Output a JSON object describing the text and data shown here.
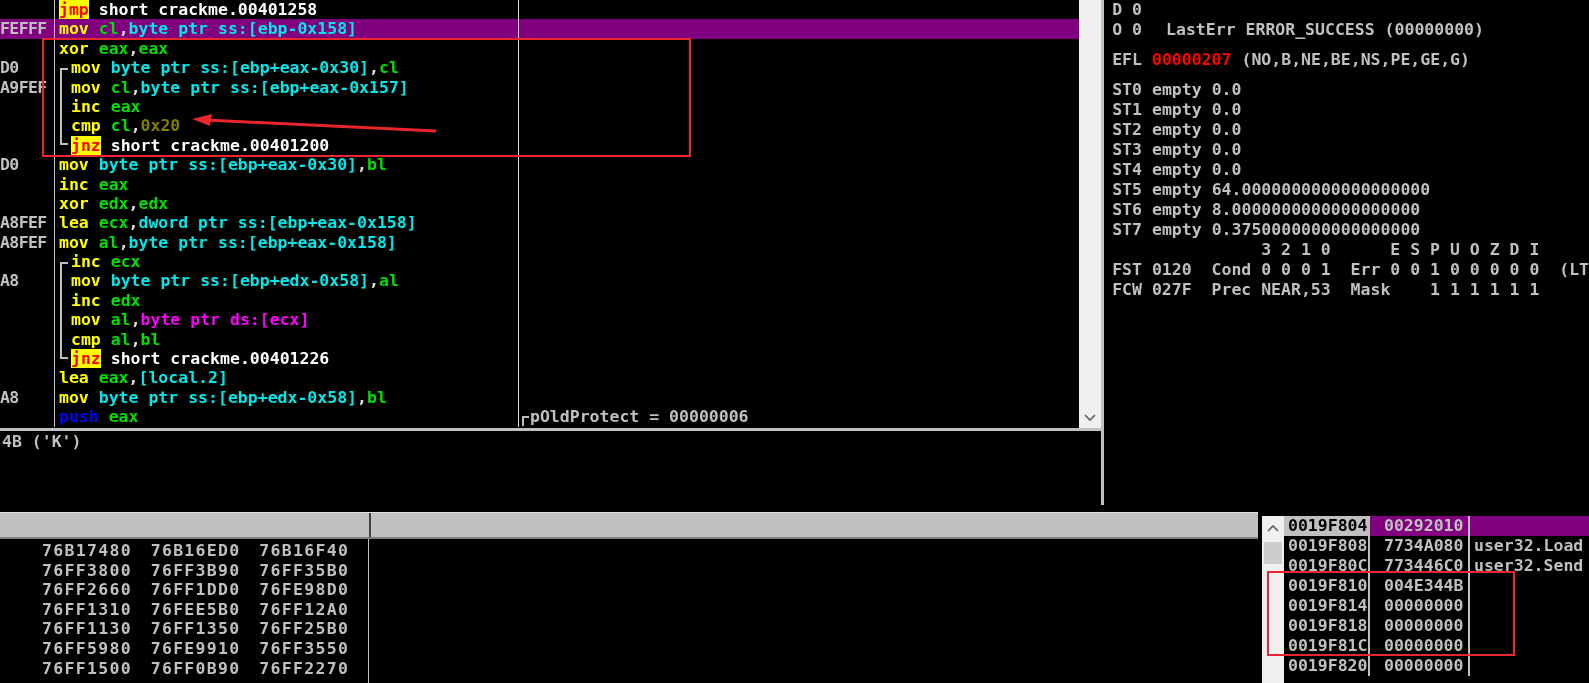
{
  "disassembly": {
    "rows": [
      {
        "bytes": "",
        "kind": "plain",
        "selected": false,
        "mnemonic": {
          "text": "jmp",
          "kind": "jump"
        },
        "operands": [
          {
            "text": "short crackme.00401258",
            "kind": "label"
          }
        ]
      },
      {
        "bytes": "FEFFF",
        "kind": "plain",
        "selected": true,
        "mnemonic": {
          "text": "mov",
          "kind": "op"
        },
        "operands": [
          {
            "text": "cl",
            "kind": "reg"
          },
          {
            "text": ",",
            "kind": "punct"
          },
          {
            "text": "byte ptr ss:[ebp-0x158]",
            "kind": "mem"
          }
        ]
      },
      {
        "bytes": "",
        "kind": "plain",
        "selected": false,
        "mnemonic": {
          "text": "xor",
          "kind": "op"
        },
        "operands": [
          {
            "text": "eax",
            "kind": "reg"
          },
          {
            "text": ",",
            "kind": "punct"
          },
          {
            "text": "eax",
            "kind": "reg"
          }
        ]
      },
      {
        "bytes": "D0",
        "kind": "loop_start",
        "selected": false,
        "mnemonic": {
          "text": "mov",
          "kind": "op"
        },
        "operands": [
          {
            "text": "byte ptr ss:[ebp+eax-0x30]",
            "kind": "mem"
          },
          {
            "text": ",",
            "kind": "punct"
          },
          {
            "text": "cl",
            "kind": "reg"
          }
        ]
      },
      {
        "bytes": "A9FEF",
        "kind": "loop_mid",
        "selected": false,
        "mnemonic": {
          "text": "mov",
          "kind": "op"
        },
        "operands": [
          {
            "text": "cl",
            "kind": "reg"
          },
          {
            "text": ",",
            "kind": "punct"
          },
          {
            "text": "byte ptr ss:[ebp+eax-0x157]",
            "kind": "mem"
          }
        ]
      },
      {
        "bytes": "",
        "kind": "loop_mid",
        "selected": false,
        "mnemonic": {
          "text": "inc",
          "kind": "op"
        },
        "operands": [
          {
            "text": "eax",
            "kind": "reg"
          }
        ]
      },
      {
        "bytes": "",
        "kind": "loop_mid",
        "selected": false,
        "mnemonic": {
          "text": "cmp",
          "kind": "op"
        },
        "operands": [
          {
            "text": "cl",
            "kind": "reg"
          },
          {
            "text": ",",
            "kind": "punct"
          },
          {
            "text": "0x20",
            "kind": "imm"
          }
        ]
      },
      {
        "bytes": "",
        "kind": "loop_end",
        "selected": false,
        "mnemonic": {
          "text": "jnz",
          "kind": "jump"
        },
        "operands": [
          {
            "text": "short crackme.00401200",
            "kind": "label"
          }
        ]
      },
      {
        "bytes": "D0",
        "kind": "plain",
        "selected": false,
        "mnemonic": {
          "text": "mov",
          "kind": "op"
        },
        "operands": [
          {
            "text": "byte ptr ss:[ebp+eax-0x30]",
            "kind": "mem"
          },
          {
            "text": ",",
            "kind": "punct"
          },
          {
            "text": "bl",
            "kind": "reg"
          }
        ]
      },
      {
        "bytes": "",
        "kind": "plain",
        "selected": false,
        "mnemonic": {
          "text": "inc",
          "kind": "op"
        },
        "operands": [
          {
            "text": "eax",
            "kind": "reg"
          }
        ]
      },
      {
        "bytes": "",
        "kind": "plain",
        "selected": false,
        "mnemonic": {
          "text": "xor",
          "kind": "op"
        },
        "operands": [
          {
            "text": "edx",
            "kind": "reg"
          },
          {
            "text": ",",
            "kind": "punct"
          },
          {
            "text": "edx",
            "kind": "reg"
          }
        ]
      },
      {
        "bytes": "A8FEF",
        "kind": "plain",
        "selected": false,
        "mnemonic": {
          "text": "lea",
          "kind": "op"
        },
        "operands": [
          {
            "text": "ecx",
            "kind": "reg"
          },
          {
            "text": ",",
            "kind": "punct"
          },
          {
            "text": "dword ptr ss:[ebp+eax-0x158]",
            "kind": "mem"
          }
        ]
      },
      {
        "bytes": "A8FEF",
        "kind": "plain",
        "selected": false,
        "mnemonic": {
          "text": "mov",
          "kind": "op"
        },
        "operands": [
          {
            "text": "al",
            "kind": "reg"
          },
          {
            "text": ",",
            "kind": "punct"
          },
          {
            "text": "byte ptr ss:[ebp+eax-0x158]",
            "kind": "mem"
          }
        ]
      },
      {
        "bytes": "",
        "kind": "loop_start",
        "selected": false,
        "mnemonic": {
          "text": "inc",
          "kind": "op"
        },
        "operands": [
          {
            "text": "ecx",
            "kind": "reg"
          }
        ]
      },
      {
        "bytes": "A8",
        "kind": "loop_mid",
        "selected": false,
        "mnemonic": {
          "text": "mov",
          "kind": "op"
        },
        "operands": [
          {
            "text": "byte ptr ss:[ebp+edx-0x58]",
            "kind": "mem"
          },
          {
            "text": ",",
            "kind": "punct"
          },
          {
            "text": "al",
            "kind": "reg"
          }
        ]
      },
      {
        "bytes": "",
        "kind": "loop_mid",
        "selected": false,
        "mnemonic": {
          "text": "inc",
          "kind": "op"
        },
        "operands": [
          {
            "text": "edx",
            "kind": "reg"
          }
        ]
      },
      {
        "bytes": "",
        "kind": "loop_mid",
        "selected": false,
        "mnemonic": {
          "text": "mov",
          "kind": "op"
        },
        "operands": [
          {
            "text": "al",
            "kind": "reg"
          },
          {
            "text": ",",
            "kind": "punct"
          },
          {
            "text": "byte ptr ds:[ecx]",
            "kind": "memds"
          }
        ]
      },
      {
        "bytes": "",
        "kind": "loop_mid",
        "selected": false,
        "mnemonic": {
          "text": "cmp",
          "kind": "op"
        },
        "operands": [
          {
            "text": "al",
            "kind": "reg"
          },
          {
            "text": ",",
            "kind": "punct"
          },
          {
            "text": "bl",
            "kind": "reg"
          }
        ]
      },
      {
        "bytes": "",
        "kind": "loop_end",
        "selected": false,
        "mnemonic": {
          "text": "jnz",
          "kind": "jump"
        },
        "operands": [
          {
            "text": "short crackme.00401226",
            "kind": "label"
          }
        ]
      },
      {
        "bytes": "",
        "kind": "plain",
        "selected": false,
        "mnemonic": {
          "text": "lea",
          "kind": "op"
        },
        "operands": [
          {
            "text": "eax",
            "kind": "reg"
          },
          {
            "text": ",",
            "kind": "punct"
          },
          {
            "text": "[local.2]",
            "kind": "mem"
          }
        ]
      },
      {
        "bytes": "A8",
        "kind": "plain",
        "selected": false,
        "mnemonic": {
          "text": "mov",
          "kind": "op"
        },
        "operands": [
          {
            "text": "byte ptr ss:[ebp+edx-0x58]",
            "kind": "mem"
          },
          {
            "text": ",",
            "kind": "punct"
          },
          {
            "text": "bl",
            "kind": "reg"
          }
        ]
      },
      {
        "bytes": "",
        "kind": "plain",
        "selected": false,
        "mnemonic": {
          "text": "push",
          "kind": "stack"
        },
        "operands": [
          {
            "text": "eax",
            "kind": "reg"
          }
        ],
        "comment": "pOldProtect = 00000006"
      }
    ]
  },
  "info": {
    "text": "4B ('K')"
  },
  "registers": {
    "groups": [
      [
        {
          "kind": "flag",
          "name": "D",
          "value": "0"
        },
        {
          "kind": "flag",
          "name": "O",
          "value": "0",
          "note": "LastErr ERROR_SUCCESS (00000000)"
        }
      ],
      [
        {
          "kind": "efl",
          "name": "EFL",
          "value": "00000207",
          "changed": true,
          "note": "(NO,B,NE,BE,NS,PE,GE,G)"
        }
      ],
      [
        {
          "kind": "fpu",
          "name": "ST0",
          "tag": "empty",
          "value": "0.0"
        },
        {
          "kind": "fpu",
          "name": "ST1",
          "tag": "empty",
          "value": "0.0"
        },
        {
          "kind": "fpu",
          "name": "ST2",
          "tag": "empty",
          "value": "0.0"
        },
        {
          "kind": "fpu",
          "name": "ST3",
          "tag": "empty",
          "value": "0.0"
        },
        {
          "kind": "fpu",
          "name": "ST4",
          "tag": "empty",
          "value": "0.0"
        },
        {
          "kind": "fpu",
          "name": "ST5",
          "tag": "empty",
          "value": "64.0000000000000000000"
        },
        {
          "kind": "fpu",
          "name": "ST6",
          "tag": "empty",
          "value": "8.0000000000000000000"
        },
        {
          "kind": "fpu",
          "name": "ST7",
          "tag": "empty",
          "value": "0.3750000000000000000"
        },
        {
          "kind": "bits",
          "text": "3 2 1 0      E S P U O Z D I"
        },
        {
          "kind": "text",
          "text": "FST 0120  Cond 0 0 0 1  Err 0 0 1 0 0 0 0 0  (LT"
        },
        {
          "kind": "text",
          "text": "FCW 027F  Prec NEAR,53  Mask    1 1 1 1 1 1"
        }
      ]
    ]
  },
  "dump": {
    "rows": [
      [
        "76B17480",
        "76B16ED0",
        "76B16F40"
      ],
      [
        "76FF3800",
        "76FF3B90",
        "76FF35B0"
      ],
      [
        "76FF2660",
        "76FF1DD0",
        "76FE98D0"
      ],
      [
        "76FF1310",
        "76FEE5B0",
        "76FF12A0"
      ],
      [
        "76FF1130",
        "76FF1350",
        "76FF25B0"
      ],
      [
        "76FF5980",
        "76FE9910",
        "76FF3550"
      ],
      [
        "76FF1500",
        "76FF0B90",
        "76FF2270"
      ]
    ]
  },
  "stack": {
    "rows": [
      {
        "address": "0019F804",
        "value": "00292010",
        "selected": true
      },
      {
        "address": "0019F808",
        "value": "7734A080",
        "comment": "user32.Load",
        "selected": false
      },
      {
        "address": "0019F80C",
        "value": "773446C0",
        "comment": "user32.Send",
        "selected": false
      },
      {
        "address": "0019F810",
        "value": "004E344B",
        "selected": false
      },
      {
        "address": "0019F814",
        "value": "00000000",
        "selected": false
      },
      {
        "address": "0019F818",
        "value": "00000000",
        "selected": false
      },
      {
        "address": "0019F81C",
        "value": "00000000",
        "selected": false
      },
      {
        "address": "0019F820",
        "value": "00000000",
        "selected": false
      }
    ]
  }
}
